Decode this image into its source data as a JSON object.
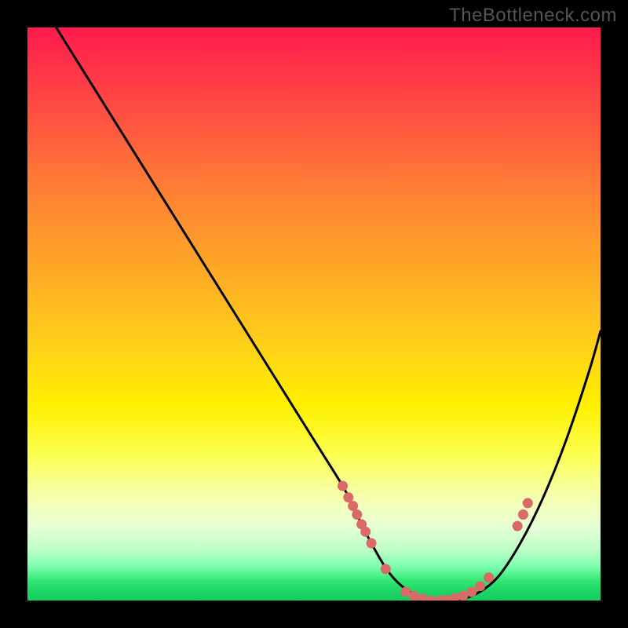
{
  "watermark": "TheBottleneck.com",
  "chart_data": {
    "type": "line",
    "title": "",
    "xlabel": "",
    "ylabel": "",
    "xlim": [
      0,
      100
    ],
    "ylim": [
      0,
      100
    ],
    "series": [
      {
        "name": "curve",
        "x": [
          5,
          10,
          15,
          20,
          25,
          30,
          35,
          40,
          45,
          50,
          55,
          57,
          60,
          63,
          66,
          70,
          74,
          78,
          82,
          86,
          90,
          94,
          98,
          100
        ],
        "y": [
          100,
          92,
          84,
          76,
          68,
          60,
          52,
          44,
          36,
          28,
          20,
          16,
          10,
          5,
          2,
          0,
          0,
          1,
          4,
          10,
          18,
          28,
          40,
          47
        ]
      }
    ],
    "markers": [
      {
        "x": 55.0,
        "y": 20.0
      },
      {
        "x": 56.0,
        "y": 18.0
      },
      {
        "x": 56.8,
        "y": 16.5
      },
      {
        "x": 57.5,
        "y": 15.0
      },
      {
        "x": 58.3,
        "y": 13.3
      },
      {
        "x": 59.0,
        "y": 12.0
      },
      {
        "x": 60.0,
        "y": 10.0
      },
      {
        "x": 62.5,
        "y": 5.5
      },
      {
        "x": 66.0,
        "y": 1.5
      },
      {
        "x": 67.5,
        "y": 0.8
      },
      {
        "x": 69.0,
        "y": 0.3
      },
      {
        "x": 70.5,
        "y": 0.0
      },
      {
        "x": 72.0,
        "y": 0.0
      },
      {
        "x": 73.0,
        "y": 0.1
      },
      {
        "x": 74.5,
        "y": 0.4
      },
      {
        "x": 76.0,
        "y": 0.8
      },
      {
        "x": 77.5,
        "y": 1.5
      },
      {
        "x": 79.0,
        "y": 2.5
      },
      {
        "x": 80.5,
        "y": 4.0
      },
      {
        "x": 85.5,
        "y": 13.0
      },
      {
        "x": 86.5,
        "y": 15.0
      },
      {
        "x": 87.3,
        "y": 17.0
      }
    ],
    "colors": {
      "curve": "#000000",
      "markers": "#d96a66",
      "gradient_top": "#ff1a4d",
      "gradient_mid": "#fff000",
      "gradient_bottom": "#15cc5e"
    }
  }
}
